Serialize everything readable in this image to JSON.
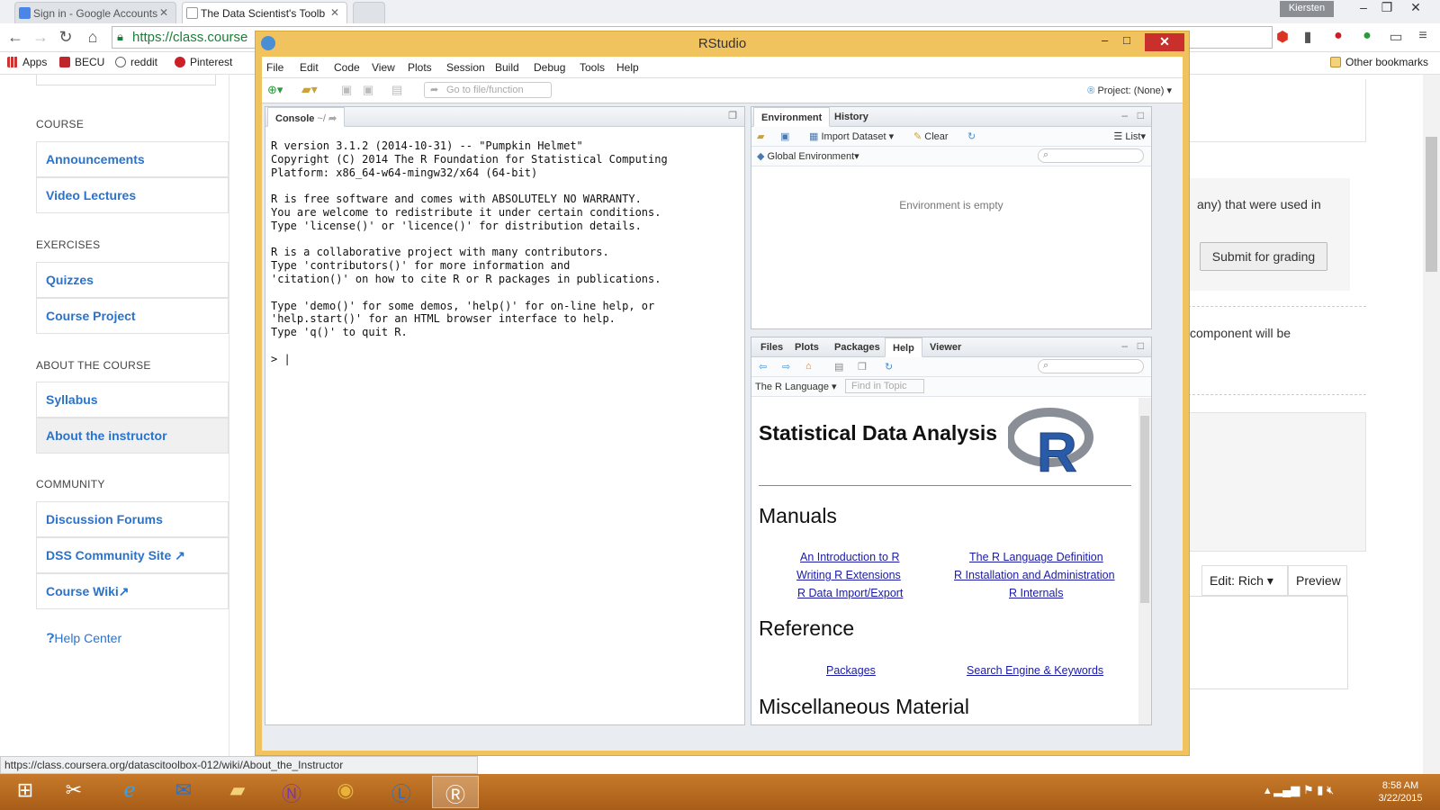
{
  "browser": {
    "tabs": [
      {
        "title": "Sign in - Google Accounts"
      },
      {
        "title": "The Data Scientist's Toolb"
      }
    ],
    "user": "Kiersten",
    "url": "https://class.course",
    "bookmarks": [
      "Apps",
      "BECU",
      "reddit",
      "Pinterest"
    ],
    "other_bookmarks": "Other bookmarks",
    "status_url": "https://class.coursera.org/datascitoolbox-012/wiki/About_the_Instructor"
  },
  "coursera": {
    "sections": [
      {
        "title": "COURSE",
        "items": [
          "Announcements",
          "Video Lectures"
        ]
      },
      {
        "title": "EXERCISES",
        "items": [
          "Quizzes",
          "Course Project"
        ]
      },
      {
        "title": "ABOUT THE COURSE",
        "items": [
          "Syllabus",
          "About the instructor"
        ]
      },
      {
        "title": "COMMUNITY",
        "items": [
          "Discussion Forums",
          "DSS Community Site",
          "Course Wiki"
        ]
      }
    ],
    "help_center": "Help Center",
    "fragment_1": "any) that were used in",
    "submit": "Submit for grading",
    "fragment_2": "component will be",
    "edit_mode": "Edit: Rich",
    "preview": "Preview"
  },
  "rstudio": {
    "title": "RStudio",
    "menu": [
      "File",
      "Edit",
      "Code",
      "View",
      "Plots",
      "Session",
      "Build",
      "Debug",
      "Tools",
      "Help"
    ],
    "goto_placeholder": "Go to file/function",
    "project": "Project: (None)",
    "console": {
      "tab": "Console",
      "path": "~/",
      "text": "R version 3.1.2 (2014-10-31) -- \"Pumpkin Helmet\"\nCopyright (C) 2014 The R Foundation for Statistical Computing\nPlatform: x86_64-w64-mingw32/x64 (64-bit)\n\nR is free software and comes with ABSOLUTELY NO WARRANTY.\nYou are welcome to redistribute it under certain conditions.\nType 'license()' or 'licence()' for distribution details.\n\nR is a collaborative project with many contributors.\nType 'contributors()' for more information and\n'citation()' on how to cite R or R packages in publications.\n\nType 'demo()' for some demos, 'help()' for on-line help, or\n'help.start()' for an HTML browser interface to help.\nType 'q()' to quit R.\n\n> |"
    },
    "env": {
      "tabs": [
        "Environment",
        "History"
      ],
      "import": "Import Dataset",
      "clear": "Clear",
      "list": "List",
      "scope": "Global Environment",
      "empty": "Environment is empty"
    },
    "help": {
      "tabs": [
        "Files",
        "Plots",
        "Packages",
        "Help",
        "Viewer"
      ],
      "topic": "The R Language",
      "find_placeholder": "Find in Topic",
      "heading": "Statistical Data Analysis",
      "manuals": "Manuals",
      "manual_links_left": [
        "An Introduction to R",
        "Writing R Extensions",
        "R Data Import/Export"
      ],
      "manual_links_right": [
        "The R Language Definition",
        "R Installation and Administration",
        "R Internals"
      ],
      "reference": "Reference",
      "ref_links": [
        "Packages",
        "Search Engine & Keywords"
      ],
      "misc": "Miscellaneous Material"
    }
  },
  "taskbar": {
    "time": "8:58 AM",
    "date": "3/22/2015"
  },
  "colors": {
    "taskbar": "#b86a22",
    "rstudio_frame": "#f1c35e",
    "link": "#2a73cc"
  }
}
